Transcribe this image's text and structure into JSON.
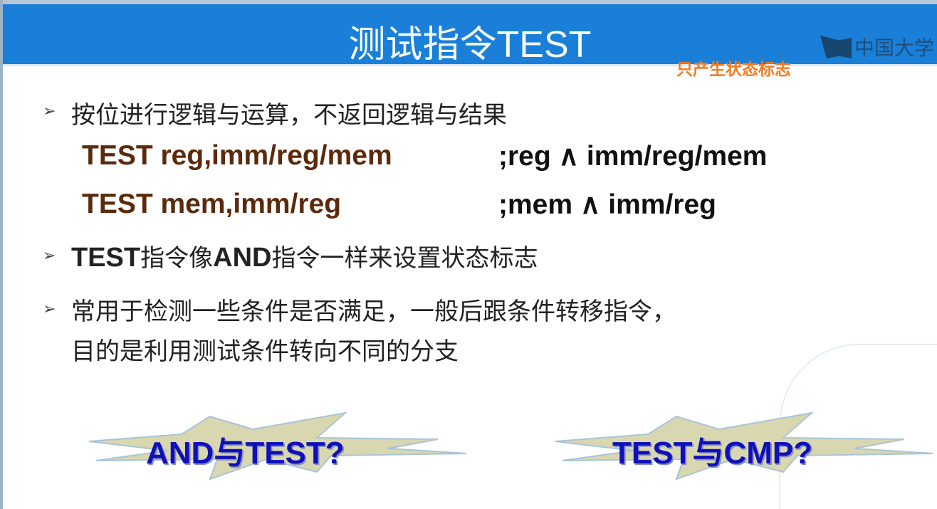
{
  "header": {
    "title": "测试指令TEST",
    "logo_text": "中国大学",
    "note": "只产生状态标志"
  },
  "bullets": [
    {
      "text": "按位进行逻辑与运算，不返回逻辑与结果"
    },
    {
      "text_bold": "TEST",
      "text_mid": "指令像",
      "text_bold2": "AND",
      "text_end": "指令一样来设置状态标志"
    },
    {
      "line1": "常用于检测一些条件是否满足，一般后跟条件转移指令，",
      "line2": "目的是利用测试条件转向不同的分支"
    }
  ],
  "code": [
    {
      "instr": "TEST reg,imm/reg/mem",
      "comment": ";reg ∧ imm/reg/mem"
    },
    {
      "instr": "TEST mem,imm/reg",
      "comment": ";mem ∧ imm/reg"
    }
  ],
  "bullet_symbol": "➢",
  "stars": [
    {
      "text": "AND与TEST?"
    },
    {
      "text": "TEST与CMP?"
    }
  ]
}
